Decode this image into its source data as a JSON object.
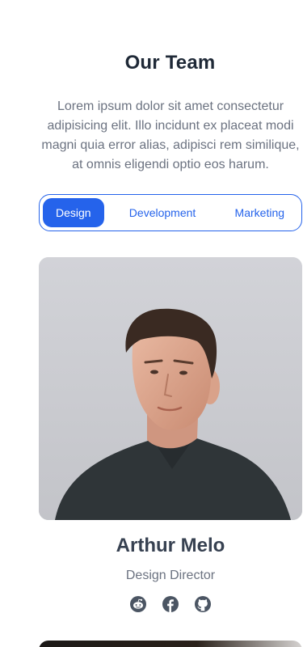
{
  "section": {
    "title": "Our Team",
    "description": "Lorem ipsum dolor sit amet consectetur adipisicing elit. Illo incidunt ex placeat modi magni quia error alias, adipisci rem similique, at omnis eligendi optio eos harum."
  },
  "tabs": [
    {
      "label": "Design",
      "active": true
    },
    {
      "label": "Development",
      "active": false
    },
    {
      "label": "Marketing",
      "active": false
    }
  ],
  "member": {
    "name": "Arthur Melo",
    "role": "Design Director",
    "socials": [
      "reddit-icon",
      "facebook-icon",
      "github-icon"
    ]
  },
  "colors": {
    "accent": "#2563eb",
    "heading": "#1f2937",
    "muted": "#6b7280"
  }
}
